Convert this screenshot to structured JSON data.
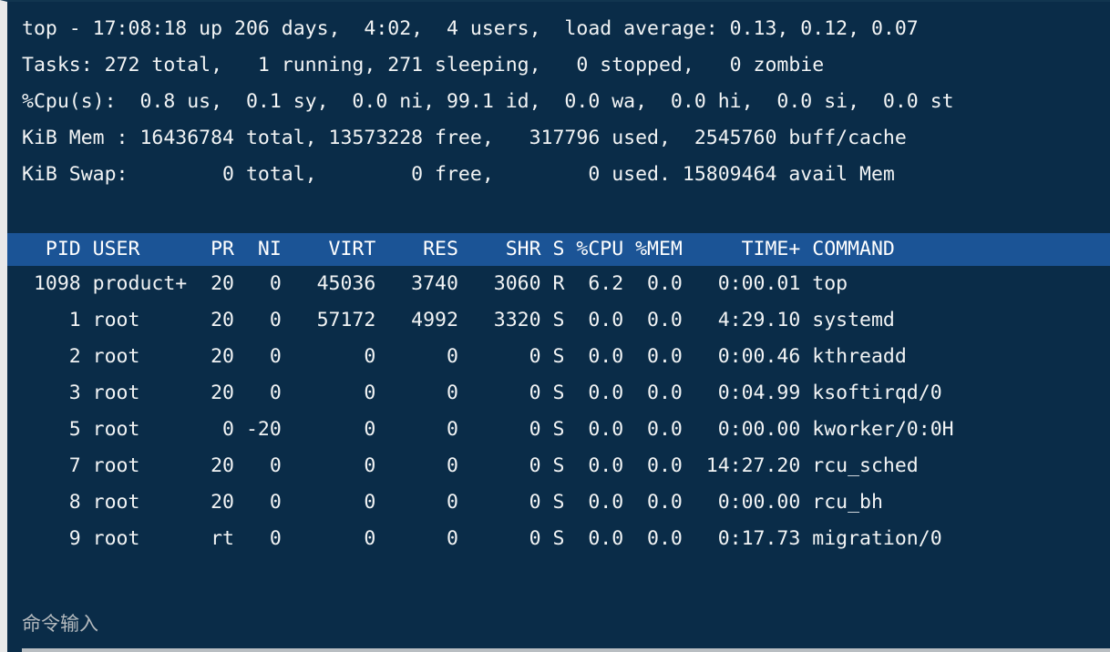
{
  "terminal": {
    "summary_lines": [
      "top - 17:08:18 up 206 days,  4:02,  4 users,  load average: 0.13, 0.12, 0.07",
      "Tasks: 272 total,   1 running, 271 sleeping,   0 stopped,   0 zombie",
      "%Cpu(s):  0.8 us,  0.1 sy,  0.0 ni, 99.1 id,  0.0 wa,  0.0 hi,  0.0 si,  0.0 st",
      "KiB Mem : 16436784 total, 13573228 free,   317796 used,  2545760 buff/cache",
      "KiB Swap:        0 total,        0 free,        0 used. 15809464 avail Mem"
    ],
    "uptime": {
      "time": "17:08:18",
      "up_days": "206 days",
      "up_hhmm": "4:02",
      "users": "4 users",
      "load_average": [
        "0.13",
        "0.12",
        "0.07"
      ]
    },
    "tasks": {
      "total": "272",
      "running": "1",
      "sleeping": "271",
      "stopped": "0",
      "zombie": "0"
    },
    "cpu": {
      "us": "0.8",
      "sy": "0.1",
      "ni": "0.0",
      "id": "99.1",
      "wa": "0.0",
      "hi": "0.0",
      "si": "0.0",
      "st": "0.0"
    },
    "mem": {
      "unit": "KiB Mem",
      "total": "16436784",
      "free": "13573228",
      "used": "317796",
      "buff_cache": "2545760"
    },
    "swap": {
      "unit": "KiB Swap",
      "total": "0",
      "free": "0",
      "used": "0",
      "avail_mem": "15809464"
    },
    "table": {
      "header_text": "  PID USER      PR  NI    VIRT    RES    SHR S %CPU %MEM     TIME+ COMMAND",
      "columns": [
        "PID",
        "USER",
        "PR",
        "NI",
        "VIRT",
        "RES",
        "SHR",
        "S",
        "%CPU",
        "%MEM",
        "TIME+",
        "COMMAND"
      ],
      "rows_text": [
        " 1098 product+  20   0   45036   3740   3060 R  6.2  0.0   0:00.01 top",
        "    1 root      20   0   57172   4992   3320 S  0.0  0.0   4:29.10 systemd",
        "    2 root      20   0       0      0      0 S  0.0  0.0   0:00.46 kthreadd",
        "    3 root      20   0       0      0      0 S  0.0  0.0   0:04.99 ksoftirqd/0",
        "    5 root       0 -20       0      0      0 S  0.0  0.0   0:00.00 kworker/0:0H",
        "    7 root      20   0       0      0      0 S  0.0  0.0  14:27.20 rcu_sched",
        "    8 root      20   0       0      0      0 S  0.0  0.0   0:00.00 rcu_bh",
        "    9 root      rt   0       0      0      0 S  0.0  0.0   0:17.73 migration/0"
      ],
      "rows": [
        {
          "pid": "1098",
          "user": "product+",
          "pr": "20",
          "ni": "0",
          "virt": "45036",
          "res": "3740",
          "shr": "3060",
          "s": "R",
          "cpu": "6.2",
          "mem": "0.0",
          "time": "0:00.01",
          "command": "top"
        },
        {
          "pid": "1",
          "user": "root",
          "pr": "20",
          "ni": "0",
          "virt": "57172",
          "res": "4992",
          "shr": "3320",
          "s": "S",
          "cpu": "0.0",
          "mem": "0.0",
          "time": "4:29.10",
          "command": "systemd"
        },
        {
          "pid": "2",
          "user": "root",
          "pr": "20",
          "ni": "0",
          "virt": "0",
          "res": "0",
          "shr": "0",
          "s": "S",
          "cpu": "0.0",
          "mem": "0.0",
          "time": "0:00.46",
          "command": "kthreadd"
        },
        {
          "pid": "3",
          "user": "root",
          "pr": "20",
          "ni": "0",
          "virt": "0",
          "res": "0",
          "shr": "0",
          "s": "S",
          "cpu": "0.0",
          "mem": "0.0",
          "time": "0:04.99",
          "command": "ksoftirqd/0"
        },
        {
          "pid": "5",
          "user": "root",
          "pr": "0",
          "ni": "-20",
          "virt": "0",
          "res": "0",
          "shr": "0",
          "s": "S",
          "cpu": "0.0",
          "mem": "0.0",
          "time": "0:00.00",
          "command": "kworker/0:0H"
        },
        {
          "pid": "7",
          "user": "root",
          "pr": "20",
          "ni": "0",
          "virt": "0",
          "res": "0",
          "shr": "0",
          "s": "S",
          "cpu": "0.0",
          "mem": "0.0",
          "time": "14:27.20",
          "command": "rcu_sched"
        },
        {
          "pid": "8",
          "user": "root",
          "pr": "20",
          "ni": "0",
          "virt": "0",
          "res": "0",
          "shr": "0",
          "s": "S",
          "cpu": "0.0",
          "mem": "0.0",
          "time": "0:00.00",
          "command": "rcu_bh"
        },
        {
          "pid": "9",
          "user": "root",
          "pr": "rt",
          "ni": "0",
          "virt": "0",
          "res": "0",
          "shr": "0",
          "s": "S",
          "cpu": "0.0",
          "mem": "0.0",
          "time": "0:17.73",
          "command": "migration/0"
        }
      ]
    },
    "command_input": {
      "placeholder": "命令输入",
      "value": ""
    },
    "colors": {
      "background": "#0a2c48",
      "header_row_background": "#1b5496",
      "text": "#f2f4f5",
      "placeholder": "#b3b9bd",
      "input_underline": "#b9bec2",
      "left_border": "#e9e9e9"
    }
  }
}
